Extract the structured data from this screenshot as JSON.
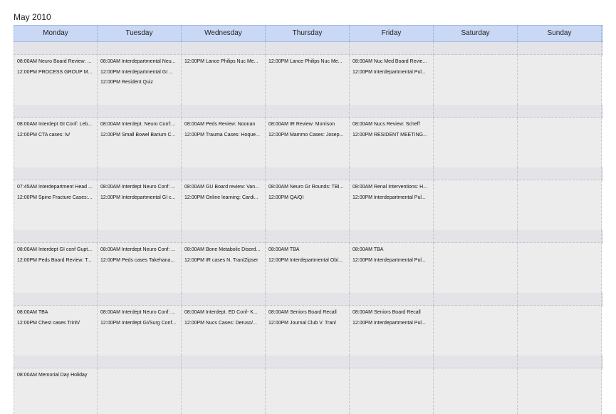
{
  "month_title": "May 2010",
  "weekdays": [
    "Monday",
    "Tuesday",
    "Wednesday",
    "Thursday",
    "Friday",
    "Saturday",
    "Sunday"
  ],
  "weeks": [
    [
      [
        "08:00AM Neuro Board Review: ...",
        "12:00PM PROCESS GROUP M..."
      ],
      [
        "08:00AM Interdepartmental Neu...",
        "12:00PM Interdepartmental GI ...",
        "12:00PM Resident Quiz"
      ],
      [
        "12:00PM Lance Philips Nuc Me..."
      ],
      [
        "12:00PM Lance Philips Nuc Me..."
      ],
      [
        "08:00AM Nuc Med Board Revie...",
        "12:00PM Interdepartmental Pul..."
      ],
      [],
      []
    ],
    [
      [
        "08:00AM Interdept GI Conf: Leb...",
        "12:00PM CTA cases: lv/"
      ],
      [
        "08:00AM Interdept. Neuro Conf:...",
        "12:00PM Small Bowel Barium C..."
      ],
      [
        "08:00AM Peds Review: Noonan",
        "12:00PM Trauma Cases: Hoque..."
      ],
      [
        "08:00AM IR Review: Morrison",
        "12:00PM Mammo Cases: Josep..."
      ],
      [
        "08:00AM Nucs Review: Scheff",
        "12:00PM RESIDENT MEETING..."
      ],
      [],
      []
    ],
    [
      [
        "07:45AM Interdepartment Head ...",
        "12:00PM Spine Fracture Cases:..."
      ],
      [
        "08:00AM Interdept Neuro Conf: ...",
        "12:00PM Interdepartmental GI c..."
      ],
      [
        "08:00AM GU Board review: Van...",
        "12:00PM Online learning: Cardi..."
      ],
      [
        "08:00AM Neuro Gr Rounds: TBI...",
        "12:00PM QA/QI"
      ],
      [
        "08:00AM Renal Interventions: H...",
        "12:00PM Interdepartmental Pul..."
      ],
      [],
      []
    ],
    [
      [
        "08:00AM Interdept GI conf Gupt...",
        "12:00PM Peds Board Review: T..."
      ],
      [
        "08:00AM Interdept Neuro Conf: ...",
        "12:00PM Peds cases Takehana..."
      ],
      [
        "08:00AM Bone Metabolic Disord...",
        "12:00PM IR cases N. Tran/Zipser"
      ],
      [
        "08:00AM TBA",
        "12:00PM Interdepartmental Ob/..."
      ],
      [
        "08:00AM TBA",
        "12:00PM Interdepartmental Pul..."
      ],
      [],
      []
    ],
    [
      [
        "08:00AM TBA",
        "12:00PM Chest cases Trinh/"
      ],
      [
        "08:00AM Interdept Neuro Conf: ...",
        "12:00PM Interdept GI/Surg Conf..."
      ],
      [
        "08:00AM Interdept. ED Conf- K...",
        "12:00PM Nucs Cases: Deruso/..."
      ],
      [
        "08:00AM Seniors Board Recall",
        "12:00PM Journal Club V. Tran/"
      ],
      [
        "08:00AM Seniors Board Recall",
        "12:00PM Interdepartmental Pul..."
      ],
      [],
      []
    ],
    [
      [
        "08:00AM Memorial Day Holiday"
      ],
      [],
      [],
      [],
      [],
      [],
      []
    ]
  ]
}
